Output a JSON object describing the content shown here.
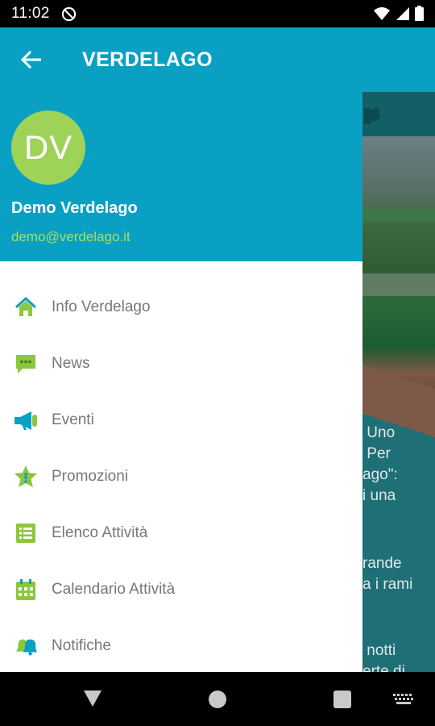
{
  "status_bar": {
    "time": "11:02",
    "icons": [
      "do-not-disturb-icon",
      "wifi-icon",
      "signal-icon",
      "battery-icon"
    ]
  },
  "app_bar": {
    "title": "VERDELAGO",
    "back_icon": "arrow-back-icon"
  },
  "drawer": {
    "header": {
      "avatar_initials": "DV",
      "name": "Demo Verdelago",
      "email": "demo@verdelago.it"
    },
    "items": [
      {
        "label": "Info Verdelago",
        "icon": "home-icon"
      },
      {
        "label": "News",
        "icon": "chat-icon"
      },
      {
        "label": "Eventi",
        "icon": "megaphone-icon"
      },
      {
        "label": "Promozioni",
        "icon": "star-badge-icon"
      },
      {
        "label": "Elenco Attività",
        "icon": "list-icon"
      },
      {
        "label": "Calendario Attività",
        "icon": "calendar-icon"
      },
      {
        "label": "Notifiche",
        "icon": "bells-icon"
      }
    ]
  },
  "background": {
    "paragraph1": " Uno\n Per\nago\":\ni una",
    "paragraph2": "rande\na i rami",
    "paragraph3": " notti\nerte di"
  },
  "nav_bar": {
    "icons": [
      "nav-back-icon",
      "nav-home-icon",
      "nav-recents-icon",
      "keyboard-icon"
    ]
  },
  "colors": {
    "primary": "#0aa0c4",
    "accent_green": "#9ed357",
    "email_green": "#a9dd5f",
    "icon_green": "#8cc63f",
    "icon_blue": "#0aa0c4",
    "menu_text": "#777777"
  }
}
